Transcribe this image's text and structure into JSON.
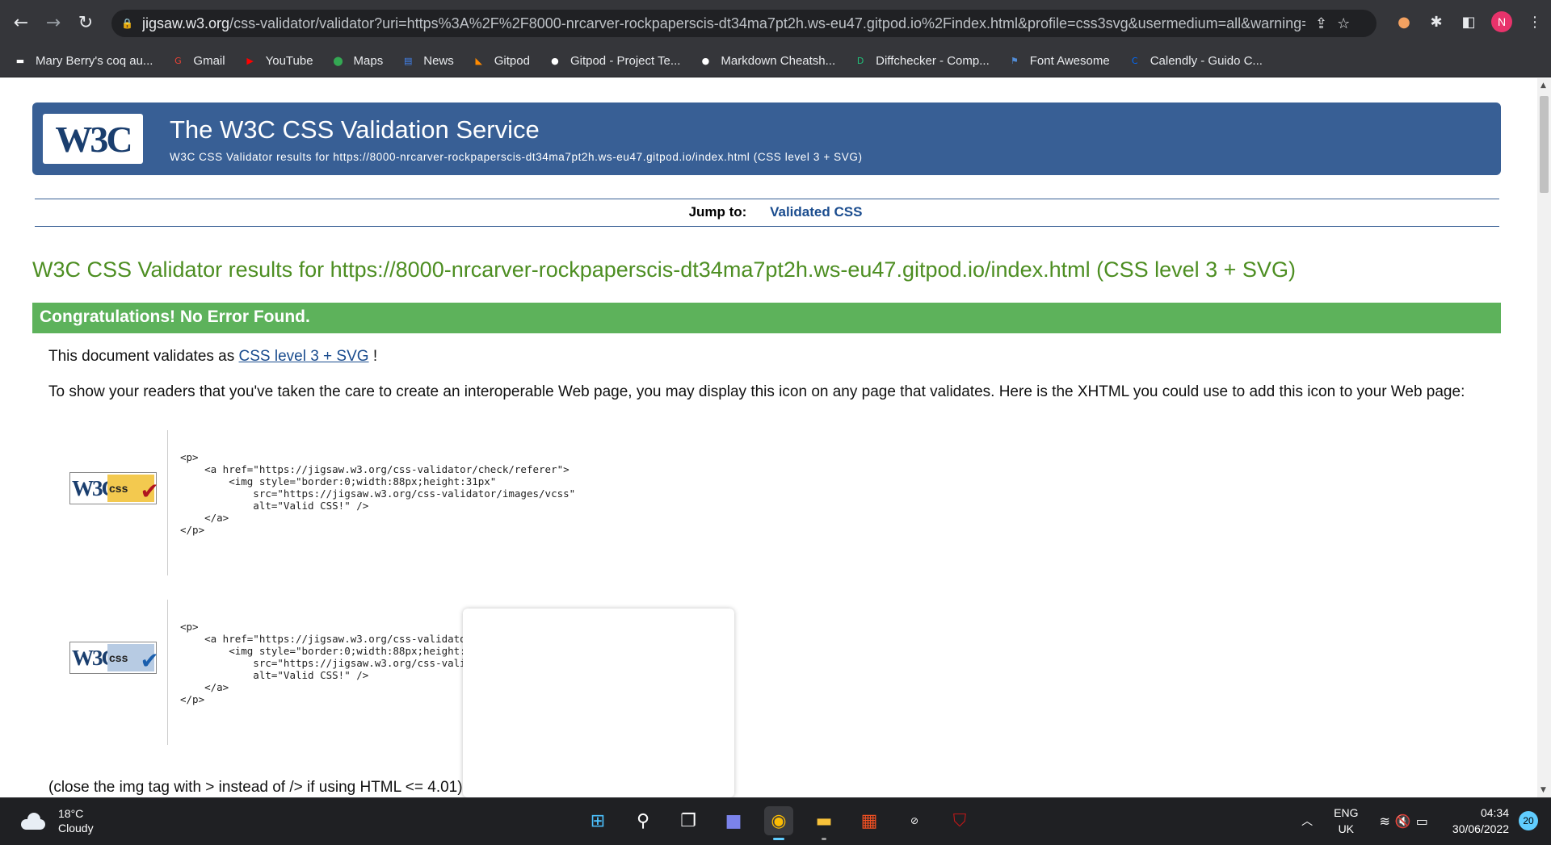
{
  "browser": {
    "url_host": "jigsaw.w3.org",
    "url_path": "/css-validator/validator?uri=https%3A%2F%2F8000-nrcarver-rockpaperscis-dt34ma7pt2h.ws-eu47.gitpod.io%2Findex.html&profile=css3svg&usermedium=all&warning=1...",
    "profile_initial": "N",
    "bookmarks": [
      {
        "label": "Mary Berry's coq au...",
        "icon": "bookmark-icon",
        "color": "#ffffff"
      },
      {
        "label": "Gmail",
        "icon": "google-icon",
        "color": "#ea4335"
      },
      {
        "label": "YouTube",
        "icon": "youtube-icon",
        "color": "#ff0000"
      },
      {
        "label": "Maps",
        "icon": "maps-icon",
        "color": "#34a853"
      },
      {
        "label": "News",
        "icon": "news-icon",
        "color": "#4285f4"
      },
      {
        "label": "Gitpod",
        "icon": "gitpod-icon",
        "color": "#ff8a00"
      },
      {
        "label": "Gitpod - Project Te...",
        "icon": "github-icon",
        "color": "#ffffff"
      },
      {
        "label": "Markdown Cheatsh...",
        "icon": "github-icon",
        "color": "#ffffff"
      },
      {
        "label": "Diffchecker - Comp...",
        "icon": "diffchecker-icon",
        "color": "#21c07a"
      },
      {
        "label": "Font Awesome",
        "icon": "flag-icon",
        "color": "#528dd7"
      },
      {
        "label": "Calendly - Guido C...",
        "icon": "calendly-icon",
        "color": "#006bff"
      }
    ]
  },
  "page": {
    "banner_title": "The W3C CSS Validation Service",
    "banner_subtitle": "W3C CSS Validator results for https://8000-nrcarver-rockpaperscis-dt34ma7pt2h.ws-eu47.gitpod.io/index.html (CSS level 3 + SVG)",
    "logo_text": "W3C",
    "jump_label": "Jump to:",
    "jump_link": "Validated CSS",
    "results_title": "W3C CSS Validator results for https://8000-nrcarver-rockpaperscis-dt34ma7pt2h.ws-eu47.gitpod.io/index.html (CSS level 3 + SVG)",
    "congrats": "Congratulations! No Error Found.",
    "validates_prefix": "This document validates as ",
    "validates_link": "CSS level 3 + SVG",
    "validates_suffix": " !",
    "icon_para": "To show your readers that you've taken the care to create an interoperable Web page, you may display this icon on any page that validates. Here is the XHTML you could use to add this icon to your Web page:",
    "badge_w3c": "W3C",
    "badge_css": "css",
    "code_gold": "<p>\n    <a href=\"https://jigsaw.w3.org/css-validator/check/referer\">\n        <img style=\"border:0;width:88px;height:31px\"\n            src=\"https://jigsaw.w3.org/css-validator/images/vcss\"\n            alt=\"Valid CSS!\" />\n    </a>\n</p>",
    "code_blue": "<p>\n    <a href=\"https://jigsaw.w3.org/css-validator/check/referer\">\n        <img style=\"border:0;width:88px;height:31px\"\n            src=\"https://jigsaw.w3.org/css-validator/images/vcss-blue\"\n            alt=\"Valid CSS!\" />\n    </a>\n</p>",
    "close_note": "(close the img tag with > instead of /> if using HTML <= 4.01)"
  },
  "taskbar": {
    "temp": "18°C",
    "condition": "Cloudy",
    "lang_1": "ENG",
    "lang_2": "UK",
    "time": "04:34",
    "date": "30/06/2022",
    "notifications": "20"
  }
}
